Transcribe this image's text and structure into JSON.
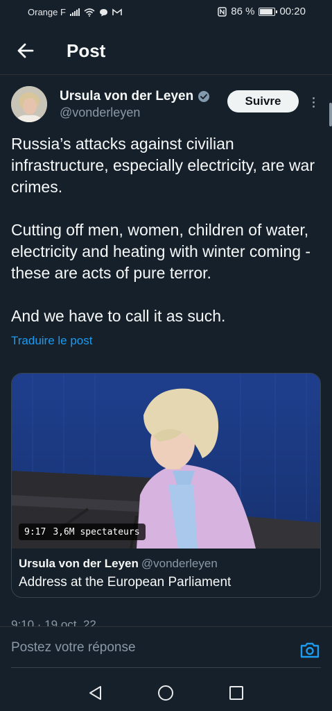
{
  "status_bar": {
    "carrier": "Orange F",
    "battery": "86 %",
    "battery_level": 0.86,
    "time": "00:20"
  },
  "header": {
    "title": "Post",
    "back_icon": "arrow-left-icon"
  },
  "author": {
    "name": "Ursula von der Leyen",
    "handle": "@vonderleyen",
    "verified_icon": "verified-badge-icon",
    "verified_color": "#829aab"
  },
  "actions": {
    "follow_label": "Suivre",
    "more_icon": "more-vertical-icon"
  },
  "post": {
    "paragraphs": [
      "Russia’s attacks against civilian infrastructure, especially electricity, are war crimes.",
      "Cutting off men, women, children of water, electricity and heating with winter coming - these are acts of pure terror.",
      "And we have to call it as such."
    ],
    "translate_label": "Traduire le post",
    "timestamp": "9:10 · 19 oct. 22"
  },
  "video_card": {
    "duration": "9:17",
    "views": "3,6M spectateurs",
    "author_name": "Ursula von der Leyen",
    "author_handle": "@vonderleyen",
    "title": "Address at the European Parliament"
  },
  "reply": {
    "placeholder": "Postez votre réponse",
    "camera_icon": "camera-icon"
  },
  "nav": {
    "back_icon": "nav-back-icon",
    "home_icon": "nav-home-icon",
    "recents_icon": "nav-recents-icon"
  },
  "colors": {
    "background": "#15202b",
    "accent": "#1d9bf0",
    "muted_text": "#8b98a5",
    "follow_button": "#eff3f4"
  }
}
